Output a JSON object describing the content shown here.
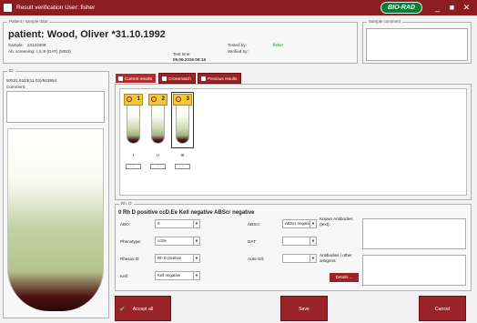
{
  "window": {
    "title": "Result verification  User: fisher",
    "logo_text": "BIO-RAD",
    "minimize_glyph": "_",
    "maximize_glyph": "■",
    "close_glyph": "✕"
  },
  "patient": {
    "legend": "Patient / sample data",
    "name": "patient: Wood, Oliver *31.10.1992",
    "sample_label": "Sample:",
    "sample_value": "23134309",
    "ab_screening_label": "Ab. screening:",
    "ab_screening_value": "I,II,III (DAT) (5053)",
    "test_time_label": "Test time:",
    "test_time_value": "09.06.2016 09:15",
    "tested_by_label": "Tested by:",
    "tested_by_value": "fisher",
    "verified_by_label": "Verified by:",
    "verified_by_value": ""
  },
  "sample_comment": {
    "legend": "Sample comment"
  },
  "left_panel": {
    "legend": "ID",
    "card_id": "50531.6313(11.03)/563954",
    "comment_label": "Comment:"
  },
  "tabs": [
    {
      "label": "Current results",
      "icon": "results-icon"
    },
    {
      "label": "Crossmatch",
      "icon": "crossmatch-icon"
    },
    {
      "label": "Previous results",
      "icon": "previous-results-icon"
    }
  ],
  "tubes": [
    {
      "number": "1",
      "label": "I",
      "value": "-",
      "selected": false
    },
    {
      "number": "2",
      "label": "II",
      "value": "-",
      "selected": false
    },
    {
      "number": "3",
      "label": "III",
      "value": "-",
      "selected": true
    }
  ],
  "result": {
    "legend": "Rh. D",
    "title": "0 Rh D positive ccD.Ee Kell negative ABScr negative",
    "abo_label": "ABO:",
    "abo_value": "0",
    "absc_label": "ABScr:",
    "absc_value": "ABScr negative",
    "phenotype_label": "Phenotype:",
    "phenotype_value": "ccDe",
    "dat_label": "DAT:",
    "dat_value": "",
    "rhesus_label": "Rhesus D:",
    "rhesus_value": "Rh D positive",
    "autoctrl_label": "Auto-ctrl:",
    "autoctrl_value": "",
    "kell_label": "Kell:",
    "kell_value": "Kell negative",
    "known_antibodies_label": "Known Antibodies (text):",
    "antibodies_other_label": "Antibodies / other antigens:",
    "details_label": "Details ..."
  },
  "actions": {
    "accept_all": "Accept all",
    "save": "Save",
    "cancel": "Cancel"
  }
}
